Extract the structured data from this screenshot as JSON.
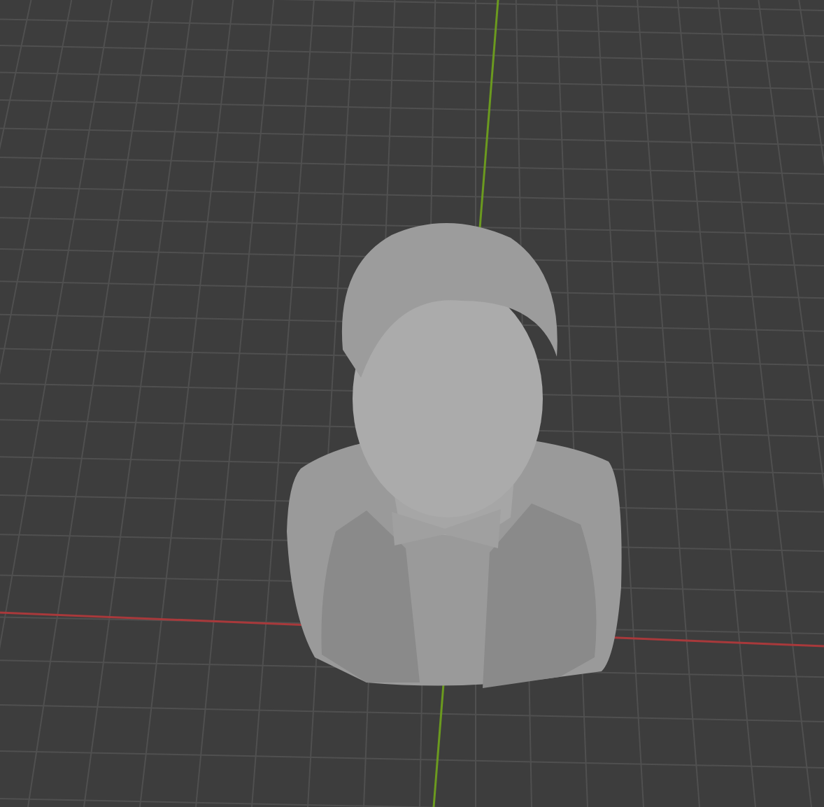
{
  "viewport": {
    "axes": [
      {
        "kind": "x",
        "color": "#a8393b"
      },
      {
        "kind": "y",
        "color": "#6b9a1f"
      }
    ],
    "model": {
      "kind": "bust"
    }
  }
}
